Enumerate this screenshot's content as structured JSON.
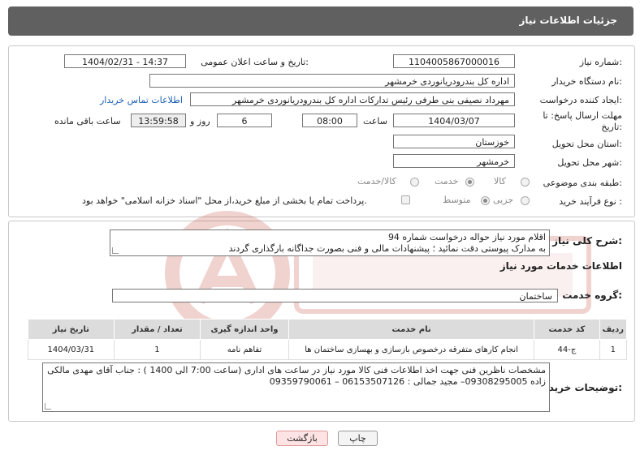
{
  "header": {
    "title": "جزئیات اطلاعات نیاز"
  },
  "form": {
    "need_number_label": "شماره نیاز:",
    "need_number": "1104005867000016",
    "announce_label": "تاریخ و ساعت اعلان عمومی:",
    "announce_value": "1404/02/31 - 14:37",
    "buyer_org_label": "نام دستگاه خریدار:",
    "buyer_org": "اداره کل بندرودریانوردی خرمشهر",
    "creator_label": "ایجاد کننده درخواست:",
    "creator": "مهرداد  نصیفی بنی طرفی رئیس تداركات اداره کل بندرودریانوردی خرمشهر",
    "contact_link": "اطلاعات تماس خریدار",
    "deadline_label_1": "مهلت ارسال پاسخ: تا",
    "deadline_label_2": "تاریخ:",
    "deadline_date": "1404/03/07",
    "time_label": "ساعت",
    "deadline_time": "08:00",
    "days_value": "6",
    "days_label": "روز و",
    "remaining_time": "13:59:58",
    "remaining_label": "ساعت باقی مانده",
    "province_label": "استان محل تحویل:",
    "province": "خوزستان",
    "city_label": "شهر محل تحویل:",
    "city": "خرمشهر",
    "category_label": "طبقه بندی موضوعی:",
    "category_options": [
      "کالا",
      "خدمت",
      "کالا/خدمت"
    ],
    "category_selected": "خدمت",
    "process_label": "نوع فرآیند خرید :",
    "process_options": [
      "جزیی",
      "متوسط"
    ],
    "process_selected": "متوسط",
    "payment_note": "پرداخت تمام یا بخشی از مبلغ خرید،از محل \"اسناد خزانه اسلامی\" خواهد بود."
  },
  "summary": {
    "label": "شرح کلی نیاز:",
    "line1": "اقلام مورد نیاز حواله درخواست شماره 94",
    "line2": "به مدارک پیوستی دقت نمائید ؛ پیشنهادات مالی و فنی بصورت جداگانه بارگذاری گردند"
  },
  "services": {
    "section_title": "اطلاعات خدمات مورد نیاز",
    "group_label": "گروه خدمت:",
    "group_value": "ساختمان",
    "columns": [
      "ردیف",
      "کد خدمت",
      "نام خدمت",
      "واحد اندازه گیری",
      "تعداد / مقدار",
      "تاریخ نیاز"
    ],
    "rows": [
      [
        "1",
        "ج-44",
        "انجام کارهای متفرقه درخصوص بازسازی و بهسازی ساختمان ها",
        "تفاهم نامه",
        "1",
        "1404/03/31"
      ]
    ]
  },
  "notes": {
    "label": "توضیحات خریدار:",
    "text": "مشخصات ناظرین فنی جهت اخذ اطلاعات فنی کالا مورد نیاز در ساعت های اداری (ساعت 7:00 الی 1400 ) : جناب آقای مهدی مالکی زاده 09308295005– مجید جمالی : 06153507126 – 09359790061"
  },
  "buttons": {
    "print": "چاپ",
    "back": "بازگشت"
  },
  "colors": {
    "header_bg": "#606060",
    "link": "#1a5fb4",
    "back_btn_bg": "#fde3e3",
    "watermark": "#c0392b"
  }
}
